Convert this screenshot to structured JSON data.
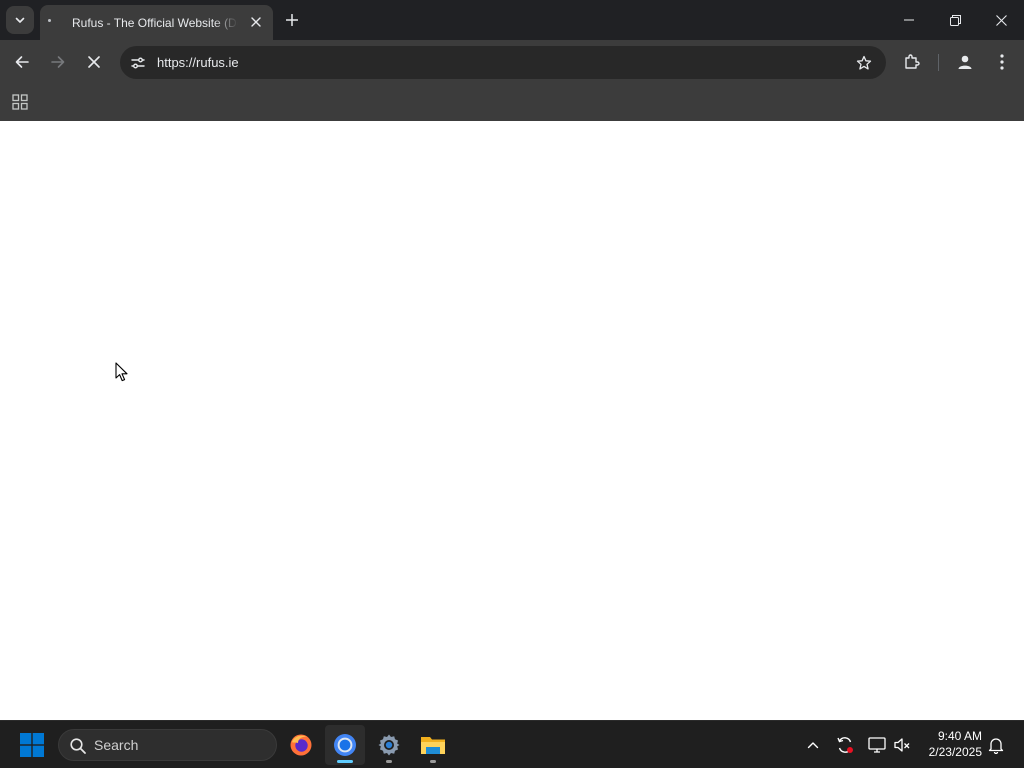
{
  "browser": {
    "tab": {
      "title": "Rufus - The Official Website (Download, New Releases, Changelog, FAQ)"
    },
    "address_bar": {
      "url": "https://rufus.ie"
    }
  },
  "taskbar": {
    "search": {
      "placeholder": "Search"
    },
    "pinned_apps": [
      "firefox",
      "chrome",
      "settings",
      "file-explorer"
    ],
    "clock": {
      "time": "9:40 AM",
      "date": "2/23/2025"
    }
  },
  "colors": {
    "tabstrip_bg": "#202124",
    "toolbar_bg": "#3c3c3c",
    "omnibox_bg": "#282828",
    "taskbar_bg": "#1f1f1f",
    "windows_blue": "#0078d4",
    "chrome_indicator": "#60cdff"
  }
}
